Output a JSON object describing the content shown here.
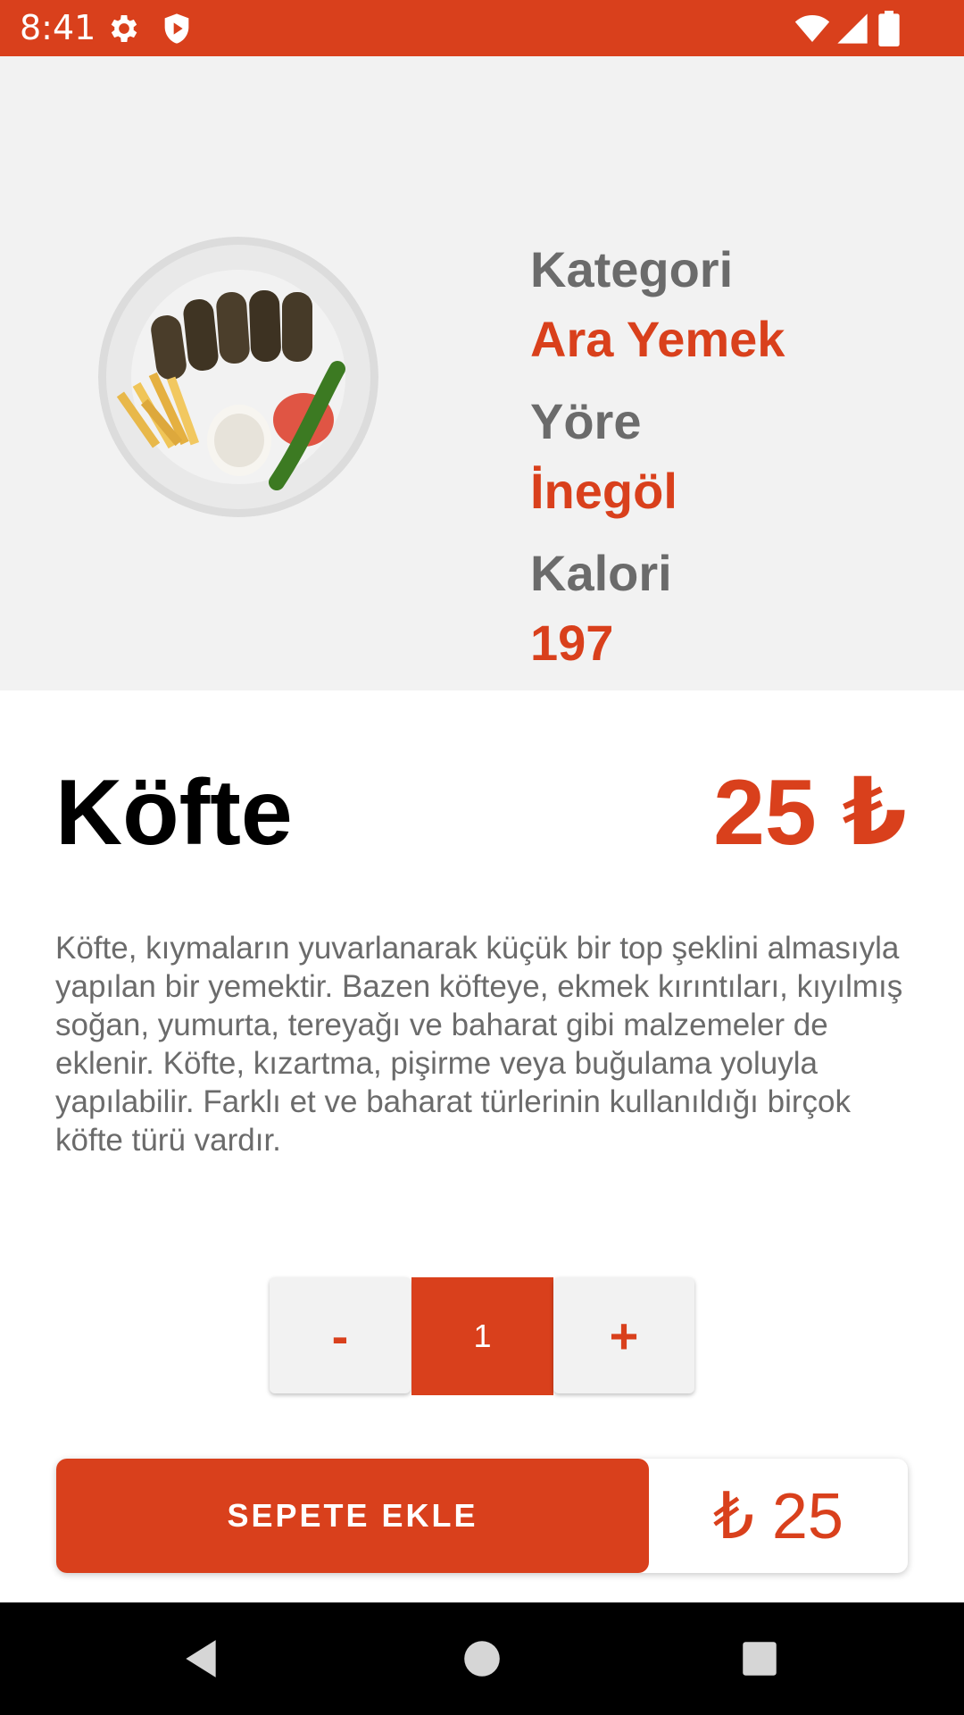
{
  "status_bar": {
    "time": "8:41",
    "background": "#D9401C",
    "left_icons": [
      "settings-icon",
      "shield-icon"
    ],
    "right_icons": [
      "wifi-icon",
      "cell-signal-icon",
      "battery-icon"
    ]
  },
  "product": {
    "image_icon": "food-plate-image",
    "category_label": "Kategori",
    "category_value": "Ara Yemek",
    "region_label": "Yöre",
    "region_value": "İnegöl",
    "calorie_label": "Kalori",
    "calorie_value": "197",
    "name": "Köfte",
    "price": "25 ₺",
    "description": "Köfte, kıymaların yuvarlanarak küçük bir top şeklini almasıyla yapılan bir yemektir. Bazen köfteye, ekmek kırıntıları, kıyılmış soğan, yumurta, tereyağı ve baharat gibi malzemeler de eklenir. Köfte, kızartma, pişirme veya buğulama yoluyla yapılabilir. Farklı et ve baharat türlerinin kullanıldığı birçok köfte türü vardır."
  },
  "quantity": {
    "minus_label": "-",
    "value": "1",
    "plus_label": "+"
  },
  "cart": {
    "add_label": "SEPETE EKLE",
    "total": "₺ 25"
  },
  "nav_bar": {
    "icons": [
      "back-icon",
      "home-icon",
      "recents-icon"
    ]
  },
  "colors": {
    "accent": "#D9401C",
    "header_bg": "#F2F2F2",
    "label_gray": "#6B6B6B",
    "title": "#000000"
  }
}
